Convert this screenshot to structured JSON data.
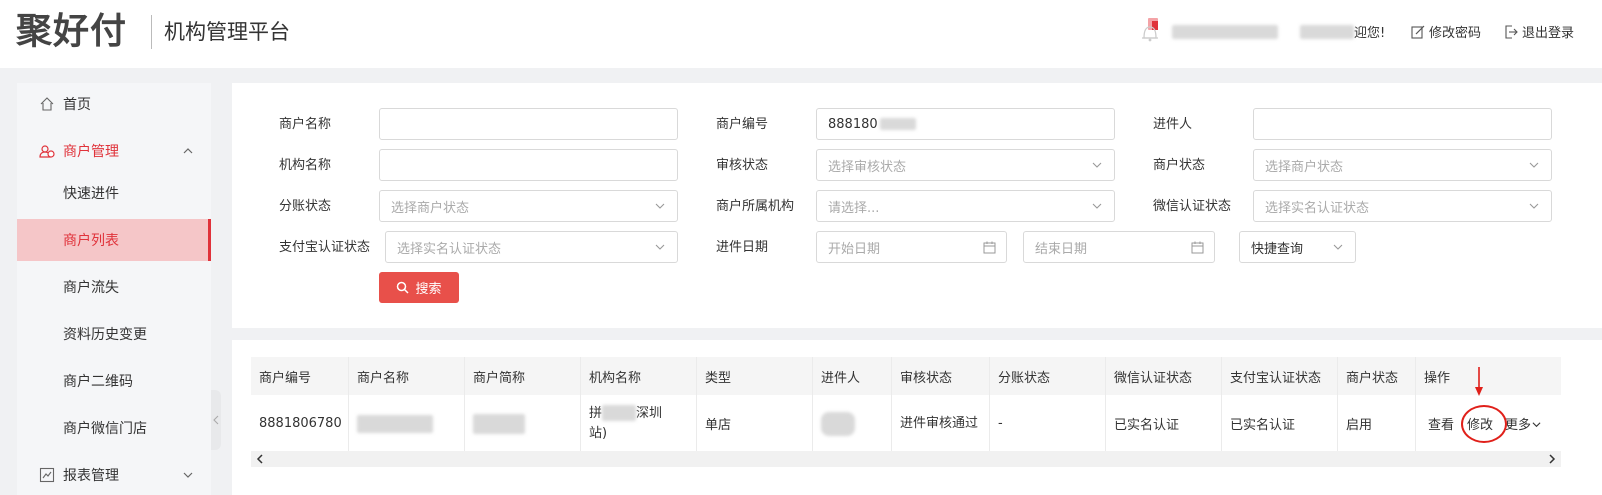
{
  "header": {
    "logo_text": "聚好付",
    "platform_title": "机构管理平台",
    "welcome_suffix": "迎您!",
    "change_password": "修改密码",
    "logout": "退出登录"
  },
  "sidebar": {
    "items": [
      {
        "label": "首页",
        "icon": "home-icon"
      },
      {
        "label": "商户管理",
        "icon": "merchant-icon"
      },
      {
        "label": "快速进件"
      },
      {
        "label": "商户列表"
      },
      {
        "label": "商户流失"
      },
      {
        "label": "资料历史变更"
      },
      {
        "label": "商户二维码"
      },
      {
        "label": "商户微信门店"
      },
      {
        "label": "报表管理",
        "icon": "report-icon"
      }
    ]
  },
  "search": {
    "merchant_name": {
      "label": "商户名称",
      "value": ""
    },
    "merchant_no": {
      "label": "商户编号",
      "value": "888180"
    },
    "submitter": {
      "label": "进件人",
      "value": ""
    },
    "org_name": {
      "label": "机构名称",
      "value": ""
    },
    "audit_status": {
      "label": "审核状态",
      "placeholder": "选择审核状态"
    },
    "merchant_status": {
      "label": "商户状态",
      "placeholder": "选择商户状态"
    },
    "split_status": {
      "label": "分账状态",
      "placeholder": "选择商户状态"
    },
    "merchant_org": {
      "label": "商户所属机构",
      "placeholder": "请选择..."
    },
    "wechat_status": {
      "label": "微信认证状态",
      "placeholder": "选择实名认证状态"
    },
    "alipay_status": {
      "label": "支付宝认证状态",
      "placeholder": "选择实名认证状态"
    },
    "submit_date": {
      "label": "进件日期",
      "start_placeholder": "开始日期",
      "end_placeholder": "结束日期"
    },
    "quick_query": "快捷查询",
    "search_button": "搜索"
  },
  "table": {
    "columns": [
      "商户编号",
      "商户名称",
      "商户简称",
      "机构名称",
      "类型",
      "进件人",
      "审核状态",
      "分账状态",
      "微信认证状态",
      "支付宝认证状态",
      "商户状态",
      "操作"
    ],
    "rows": [
      {
        "merchant_no": "8881806780",
        "merchant_name": "",
        "short_name": "",
        "org_name_line1": "拼",
        "org_name_suffix": "深圳",
        "org_name_line2": "站)",
        "type": "单店",
        "submitter": "",
        "audit_status": "进件审核通过",
        "split_status": "-",
        "wechat_status": "已实名认证",
        "alipay_status": "已实名认证",
        "merchant_status": "启用",
        "ops": {
          "view": "查看",
          "edit": "修改",
          "more": "更多"
        }
      }
    ]
  },
  "colors": {
    "accent": "#e0323a",
    "search_button": "#e8504a",
    "active_menu_bg": "#f5c6c8"
  }
}
